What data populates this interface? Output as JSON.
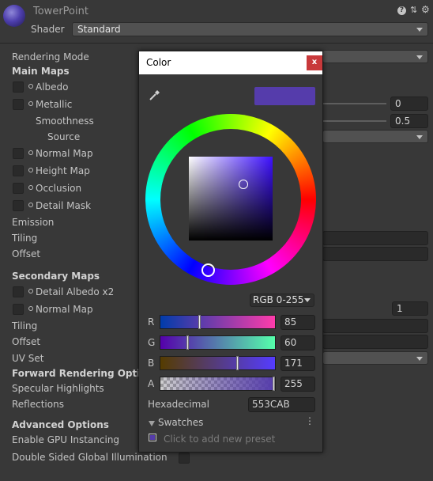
{
  "header": {
    "title": "TowerPoint",
    "shader_label": "Shader",
    "shader_value": "Standard",
    "icons": [
      "help-icon",
      "presets-icon",
      "settings-icon"
    ]
  },
  "inspector": {
    "rendering_mode_label": "Rendering Mode",
    "main_maps": "Main Maps",
    "albedo": "Albedo",
    "metallic": "Metallic",
    "metallic_value": "0",
    "smoothness": "Smoothness",
    "smoothness_value": "0.5",
    "source": "Source",
    "normal_map": "Normal Map",
    "height_map": "Height Map",
    "occlusion": "Occlusion",
    "detail_mask": "Detail Mask",
    "emission": "Emission",
    "tiling": "Tiling",
    "offset": "Offset",
    "secondary_maps": "Secondary Maps",
    "detail_albedo": "Detail Albedo x2",
    "normal_map_2": "Normal Map",
    "normal_map_2_value": "1",
    "tiling_2": "Tiling",
    "offset_2": "Offset",
    "uv_set": "UV Set",
    "forward_rendering": "Forward Rendering Options",
    "specular_highlights": "Specular Highlights",
    "reflections": "Reflections",
    "advanced_options": "Advanced Options",
    "gpu_instancing": "Enable GPU Instancing",
    "double_sided": "Double Sided Global Illumination"
  },
  "color_picker": {
    "title": "Color",
    "close": "x",
    "mode": "RGB 0-255",
    "current_color": "#553CAB",
    "channels": [
      {
        "label": "R",
        "value": "85"
      },
      {
        "label": "G",
        "value": "60"
      },
      {
        "label": "B",
        "value": "171"
      },
      {
        "label": "A",
        "value": "255"
      }
    ],
    "hex_label": "Hexadecimal",
    "hex_value": "553CAB",
    "swatches_label": "Swatches",
    "swatch_hint": "Click to add new preset"
  },
  "colors": {
    "accent": "#553CAB",
    "close_button": "#c8393b",
    "background": "#383838"
  }
}
